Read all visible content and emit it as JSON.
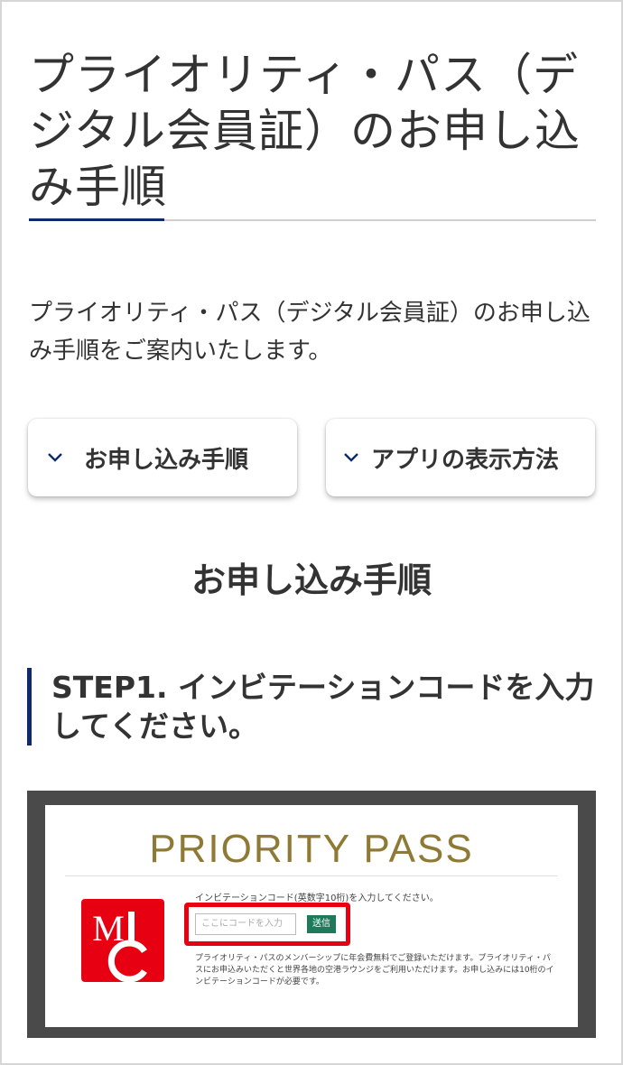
{
  "page": {
    "title": "プライオリティ・パス（デジタル会員証）のお申し込み手順",
    "intro": "プライオリティ・パス（デジタル会員証）のお申し込み手順をご案内いたします。"
  },
  "anchors": [
    {
      "label": "お申し込み手順",
      "icon": "chevron-down-icon"
    },
    {
      "label": "アプリの表示方法",
      "icon": "chevron-down-icon"
    }
  ],
  "section": {
    "heading": "お申し込み手順"
  },
  "step1": {
    "heading": "STEP1. インビテーションコードを入力してください。"
  },
  "screenshot": {
    "brand_title": "PRIORITY PASS",
    "code_label": "インビテーションコード(英数字10桁)を入力してください。",
    "input_placeholder": "ここにコードを入力",
    "send_label": "送信",
    "description": "プライオリティ・パスのメンバーシップに年会費無料でご登録いただけます。プライオリティ・パスにお申込みいただくと世界各地の空港ラウンジをご利用いただけます。お申し込みには10桁のインビテーションコードが必要です。",
    "logo_icon": "mufg-card-logo-icon"
  },
  "colors": {
    "accent": "#0f2a6b",
    "brand_gold": "#8f7a35",
    "highlight_red": "#e60012",
    "send_green": "#1e7a5a"
  }
}
